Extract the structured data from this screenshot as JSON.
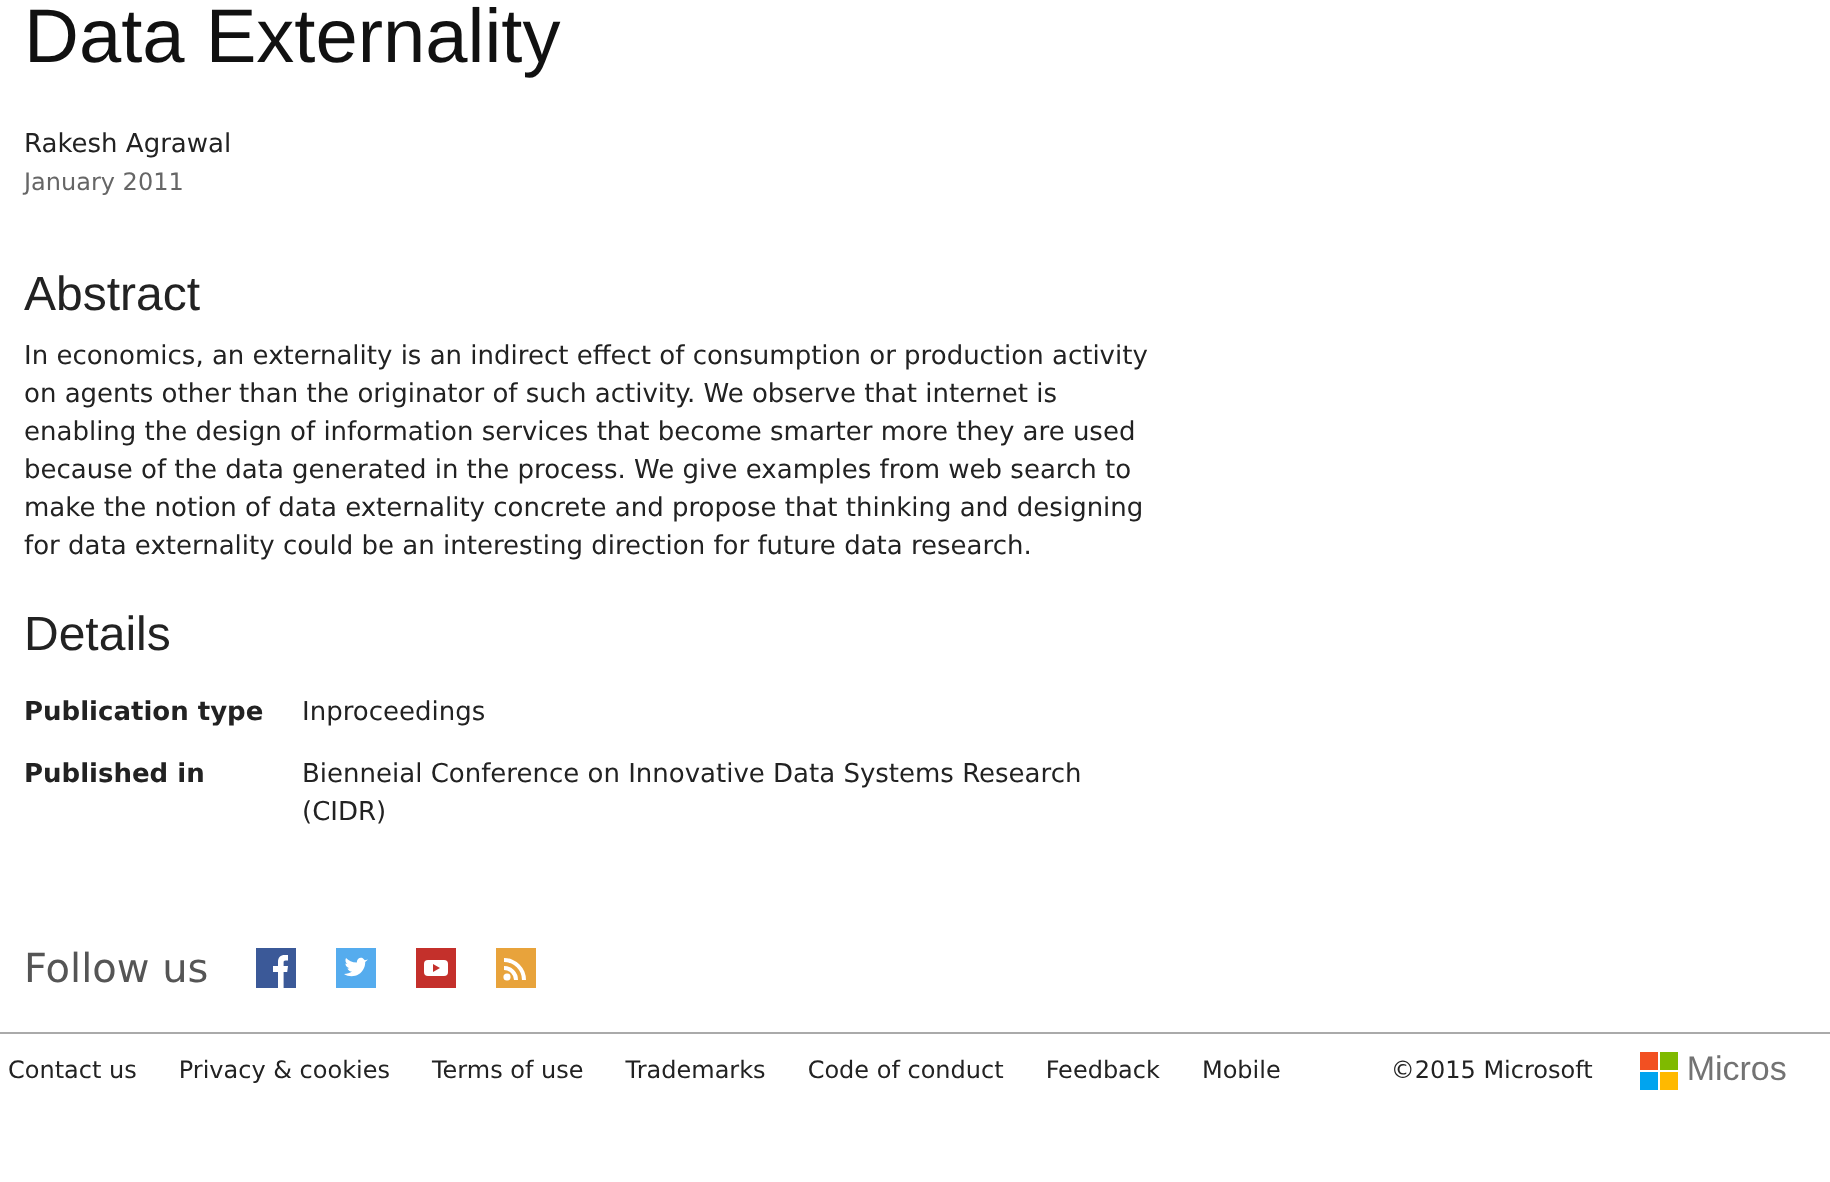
{
  "title": "Data Externality",
  "author": "Rakesh Agrawal",
  "date": "January 2011",
  "abstract": {
    "heading": "Abstract",
    "text": "In economics, an externality is an indirect effect of consumption or production activity on agents other than the originator of such activity. We observe that internet is enabling the design of information services that become smarter more they are used because of the data generated in the process. We give examples from web search to make the notion of data externality concrete and propose that thinking and designing for data externality could be an interesting direction for future data research."
  },
  "details": {
    "heading": "Details",
    "rows": [
      {
        "label": "Publication type",
        "value": "Inproceedings"
      },
      {
        "label": "Published in",
        "value": "Bienneial Conference on Innovative Data Systems Research (CIDR)"
      }
    ]
  },
  "follow": {
    "label": "Follow us",
    "icons": [
      {
        "kind": "facebook"
      },
      {
        "kind": "twitter"
      },
      {
        "kind": "youtube"
      },
      {
        "kind": "rss"
      }
    ]
  },
  "footer": {
    "links": [
      "Contact us",
      "Privacy & cookies",
      "Terms of use",
      "Trademarks",
      "Code of conduct",
      "Feedback",
      "Mobile"
    ],
    "copyright": "©2015 Microsoft",
    "logo_text": "Micros"
  }
}
